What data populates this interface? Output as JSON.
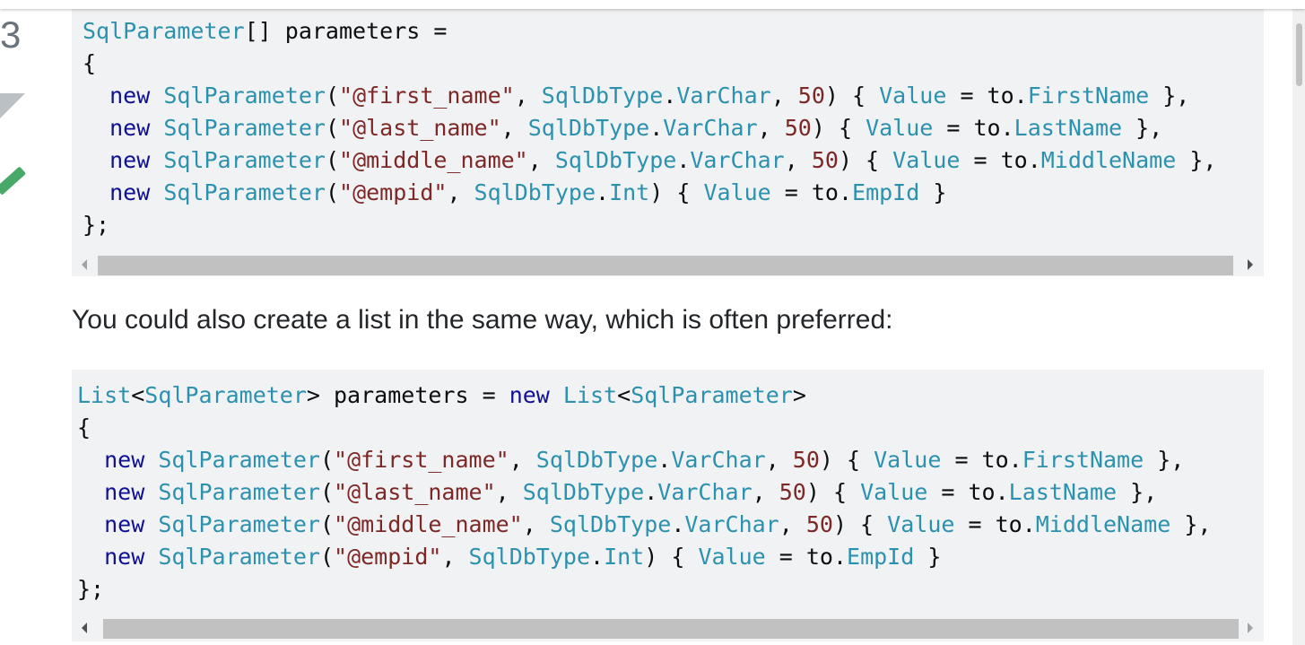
{
  "vote": {
    "count": "3"
  },
  "code_block_1": {
    "lines": [
      [
        [
          "t",
          "SqlParameter"
        ],
        [
          "p",
          "[] parameters ="
        ]
      ],
      [
        [
          "p",
          "{"
        ]
      ],
      [
        [
          "p",
          "  "
        ],
        [
          "k",
          "new"
        ],
        [
          "p",
          " "
        ],
        [
          "t",
          "SqlParameter"
        ],
        [
          "p",
          "("
        ],
        [
          "s",
          "\"@first_name\""
        ],
        [
          "p",
          ", "
        ],
        [
          "t",
          "SqlDbType"
        ],
        [
          "p",
          "."
        ],
        [
          "t",
          "VarChar"
        ],
        [
          "p",
          ", "
        ],
        [
          "n",
          "50"
        ],
        [
          "p",
          ") { "
        ],
        [
          "t",
          "Value"
        ],
        [
          "p",
          " = to."
        ],
        [
          "t",
          "FirstName"
        ],
        [
          "p",
          " },"
        ]
      ],
      [
        [
          "p",
          "  "
        ],
        [
          "k",
          "new"
        ],
        [
          "p",
          " "
        ],
        [
          "t",
          "SqlParameter"
        ],
        [
          "p",
          "("
        ],
        [
          "s",
          "\"@last_name\""
        ],
        [
          "p",
          ", "
        ],
        [
          "t",
          "SqlDbType"
        ],
        [
          "p",
          "."
        ],
        [
          "t",
          "VarChar"
        ],
        [
          "p",
          ", "
        ],
        [
          "n",
          "50"
        ],
        [
          "p",
          ") { "
        ],
        [
          "t",
          "Value"
        ],
        [
          "p",
          " = to."
        ],
        [
          "t",
          "LastName"
        ],
        [
          "p",
          " },"
        ]
      ],
      [
        [
          "p",
          "  "
        ],
        [
          "k",
          "new"
        ],
        [
          "p",
          " "
        ],
        [
          "t",
          "SqlParameter"
        ],
        [
          "p",
          "("
        ],
        [
          "s",
          "\"@middle_name\""
        ],
        [
          "p",
          ", "
        ],
        [
          "t",
          "SqlDbType"
        ],
        [
          "p",
          "."
        ],
        [
          "t",
          "VarChar"
        ],
        [
          "p",
          ", "
        ],
        [
          "n",
          "50"
        ],
        [
          "p",
          ") { "
        ],
        [
          "t",
          "Value"
        ],
        [
          "p",
          " = to."
        ],
        [
          "t",
          "MiddleName"
        ],
        [
          "p",
          " },"
        ]
      ],
      [
        [
          "p",
          "  "
        ],
        [
          "k",
          "new"
        ],
        [
          "p",
          " "
        ],
        [
          "t",
          "SqlParameter"
        ],
        [
          "p",
          "("
        ],
        [
          "s",
          "\"@empid\""
        ],
        [
          "p",
          ", "
        ],
        [
          "t",
          "SqlDbType"
        ],
        [
          "p",
          "."
        ],
        [
          "t",
          "Int"
        ],
        [
          "p",
          ") { "
        ],
        [
          "t",
          "Value"
        ],
        [
          "p",
          " = to."
        ],
        [
          "t",
          "EmpId"
        ],
        [
          "p",
          " }"
        ]
      ],
      [
        [
          "p",
          "};"
        ]
      ]
    ]
  },
  "prose": {
    "text": "You could also create a list in the same way, which is often preferred:"
  },
  "code_block_2": {
    "lines": [
      [
        [
          "t",
          "List"
        ],
        [
          "p",
          "<"
        ],
        [
          "t",
          "SqlParameter"
        ],
        [
          "p",
          "> parameters = "
        ],
        [
          "k",
          "new"
        ],
        [
          "p",
          " "
        ],
        [
          "t",
          "List"
        ],
        [
          "p",
          "<"
        ],
        [
          "t",
          "SqlParameter"
        ],
        [
          "p",
          ">"
        ]
      ],
      [
        [
          "p",
          "{"
        ]
      ],
      [
        [
          "p",
          "  "
        ],
        [
          "k",
          "new"
        ],
        [
          "p",
          " "
        ],
        [
          "t",
          "SqlParameter"
        ],
        [
          "p",
          "("
        ],
        [
          "s",
          "\"@first_name\""
        ],
        [
          "p",
          ", "
        ],
        [
          "t",
          "SqlDbType"
        ],
        [
          "p",
          "."
        ],
        [
          "t",
          "VarChar"
        ],
        [
          "p",
          ", "
        ],
        [
          "n",
          "50"
        ],
        [
          "p",
          ") { "
        ],
        [
          "t",
          "Value"
        ],
        [
          "p",
          " = to."
        ],
        [
          "t",
          "FirstName"
        ],
        [
          "p",
          " },"
        ]
      ],
      [
        [
          "p",
          "  "
        ],
        [
          "k",
          "new"
        ],
        [
          "p",
          " "
        ],
        [
          "t",
          "SqlParameter"
        ],
        [
          "p",
          "("
        ],
        [
          "s",
          "\"@last_name\""
        ],
        [
          "p",
          ", "
        ],
        [
          "t",
          "SqlDbType"
        ],
        [
          "p",
          "."
        ],
        [
          "t",
          "VarChar"
        ],
        [
          "p",
          ", "
        ],
        [
          "n",
          "50"
        ],
        [
          "p",
          ") { "
        ],
        [
          "t",
          "Value"
        ],
        [
          "p",
          " = to."
        ],
        [
          "t",
          "LastName"
        ],
        [
          "p",
          " },"
        ]
      ],
      [
        [
          "p",
          "  "
        ],
        [
          "k",
          "new"
        ],
        [
          "p",
          " "
        ],
        [
          "t",
          "SqlParameter"
        ],
        [
          "p",
          "("
        ],
        [
          "s",
          "\"@middle_name\""
        ],
        [
          "p",
          ", "
        ],
        [
          "t",
          "SqlDbType"
        ],
        [
          "p",
          "."
        ],
        [
          "t",
          "VarChar"
        ],
        [
          "p",
          ", "
        ],
        [
          "n",
          "50"
        ],
        [
          "p",
          ") { "
        ],
        [
          "t",
          "Value"
        ],
        [
          "p",
          " = to."
        ],
        [
          "t",
          "MiddleName"
        ],
        [
          "p",
          " },"
        ]
      ],
      [
        [
          "p",
          "  "
        ],
        [
          "k",
          "new"
        ],
        [
          "p",
          " "
        ],
        [
          "t",
          "SqlParameter"
        ],
        [
          "p",
          "("
        ],
        [
          "s",
          "\"@empid\""
        ],
        [
          "p",
          ", "
        ],
        [
          "t",
          "SqlDbType"
        ],
        [
          "p",
          "."
        ],
        [
          "t",
          "Int"
        ],
        [
          "p",
          ") { "
        ],
        [
          "t",
          "Value"
        ],
        [
          "p",
          " = to."
        ],
        [
          "t",
          "EmpId"
        ],
        [
          "p",
          " }"
        ]
      ],
      [
        [
          "p",
          "};"
        ]
      ]
    ]
  },
  "colors": {
    "code_background": "#f1f2f3",
    "type_name": "#2b91af",
    "keyword": "#101094",
    "string_literal": "#7d2727",
    "accepted_check": "#48a868"
  },
  "icons": {
    "vote_down": "vote-down-arrow-icon",
    "accepted": "accepted-checkmark-icon",
    "scroll_left": "scroll-left-arrow-icon",
    "scroll_right": "scroll-right-arrow-icon"
  }
}
